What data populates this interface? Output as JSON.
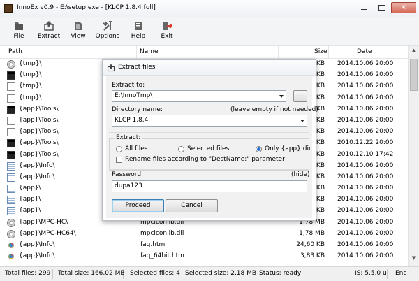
{
  "window": {
    "title": "InnoEx v0.9 - E:\\setup.exe - [KLCP 1.8.4 full]",
    "close_glyph": "×"
  },
  "toolbar": {
    "buttons": [
      {
        "label": "File",
        "icon": "file-icon"
      },
      {
        "label": "Extract",
        "icon": "extract-icon"
      },
      {
        "label": "View",
        "icon": "view-icon"
      },
      {
        "label": "Options",
        "icon": "options-icon"
      },
      {
        "label": "Help",
        "icon": "help-icon"
      },
      {
        "label": "Exit",
        "icon": "exit-icon"
      }
    ]
  },
  "list": {
    "columns": {
      "path": "Path",
      "name": "Name",
      "size": "Size",
      "date": "Date"
    },
    "rows": [
      {
        "path": "{tmp}\\",
        "name": "",
        "size": "KB",
        "date": "2014.10.06 20:00",
        "icon": "gear"
      },
      {
        "path": "{tmp}\\",
        "name": "",
        "size": "KB",
        "date": "2014.10.06 20:00",
        "icon": "black"
      },
      {
        "path": "{tmp}\\",
        "name": "",
        "size": "KB",
        "date": "2014.10.06 20:00",
        "icon": "doc"
      },
      {
        "path": "{tmp}\\",
        "name": "",
        "size": "KB",
        "date": "2014.10.06 20:00",
        "icon": "doc"
      },
      {
        "path": "{app}\\Tools\\",
        "name": "",
        "size": "KB",
        "date": "2014.10.06 20:00",
        "icon": "black"
      },
      {
        "path": "{app}\\Tools\\",
        "name": "",
        "size": "KB",
        "date": "2014.10.06 20:00",
        "icon": "doc"
      },
      {
        "path": "{app}\\Tools\\",
        "name": "",
        "size": "KB",
        "date": "2014.10.06 20:00",
        "icon": "doc"
      },
      {
        "path": "{app}\\Tools\\",
        "name": "",
        "size": "KB",
        "date": "2010.12.22 20:00",
        "icon": "black"
      },
      {
        "path": "{app}\\Tools\\",
        "name": "",
        "size": "KB",
        "date": "2010.12.10 17:42",
        "icon": "black"
      },
      {
        "path": "{app}\\Info\\",
        "name": "",
        "size": "KB",
        "date": "2014.10.06 20:00",
        "icon": "text"
      },
      {
        "path": "{app}\\Info\\",
        "name": "",
        "size": "KB",
        "date": "2014.10.06 20:00",
        "icon": "text"
      },
      {
        "path": "{app}\\",
        "name": "",
        "size": "KB",
        "date": "2014.10.06 20:00",
        "icon": "text"
      },
      {
        "path": "{app}\\",
        "name": "",
        "size": "KB",
        "date": "2014.10.06 20:00",
        "icon": "text"
      },
      {
        "path": "{app}\\",
        "name": "",
        "size": "KB",
        "date": "2014.10.06 20:00",
        "icon": "text"
      },
      {
        "path": "{app}\\MPC-HC\\",
        "name": "mpciconlib.dll",
        "size": "1,78 MB",
        "date": "2014.10.06 20:00",
        "icon": "gear"
      },
      {
        "path": "{app}\\MPC-HC64\\",
        "name": "mpciconlib.dll",
        "size": "1,78 MB",
        "date": "2014.10.06 20:00",
        "icon": "gear"
      },
      {
        "path": "{app}\\Info\\",
        "name": "faq.htm",
        "size": "24,60 KB",
        "date": "2014.10.06 20:00",
        "icon": "chrome"
      },
      {
        "path": "{app}\\Info\\",
        "name": "faq_64bit.htm",
        "size": "3,83 KB",
        "date": "2014.10.06 20:00",
        "icon": "chrome"
      }
    ]
  },
  "scrollbar": {
    "up_glyph": "▲",
    "down_glyph": "▼"
  },
  "status": {
    "total_files": "Total files: 299",
    "total_size": "Total size: 166,02 MB",
    "selected_files": "Selected files: 4",
    "selected_size": "Selected size: 2,18 MB",
    "status": "Status: ready",
    "is": "IS: 5.5.0 u",
    "enc": "Enc"
  },
  "dialog": {
    "title": "Extract files",
    "extract_to_label": "Extract to:",
    "extract_to_value": "E:\\InnoTmp\\",
    "browse_label": "...",
    "dirname_label": "Directory name:",
    "dirname_hint": "(leave empty if not needed)",
    "dirname_value": "KLCP 1.8.4",
    "extract_group_label": "Extract:",
    "radio_all": "All files",
    "radio_selected": "Selected files",
    "radio_app": "Only {app} dir",
    "rename_label": "Rename files according to \"DestName:\" parameter",
    "password_label": "Password:",
    "password_hide": "(hide)",
    "password_value": "dupa123",
    "proceed_label": "Proceed",
    "cancel_label": "Cancel"
  }
}
